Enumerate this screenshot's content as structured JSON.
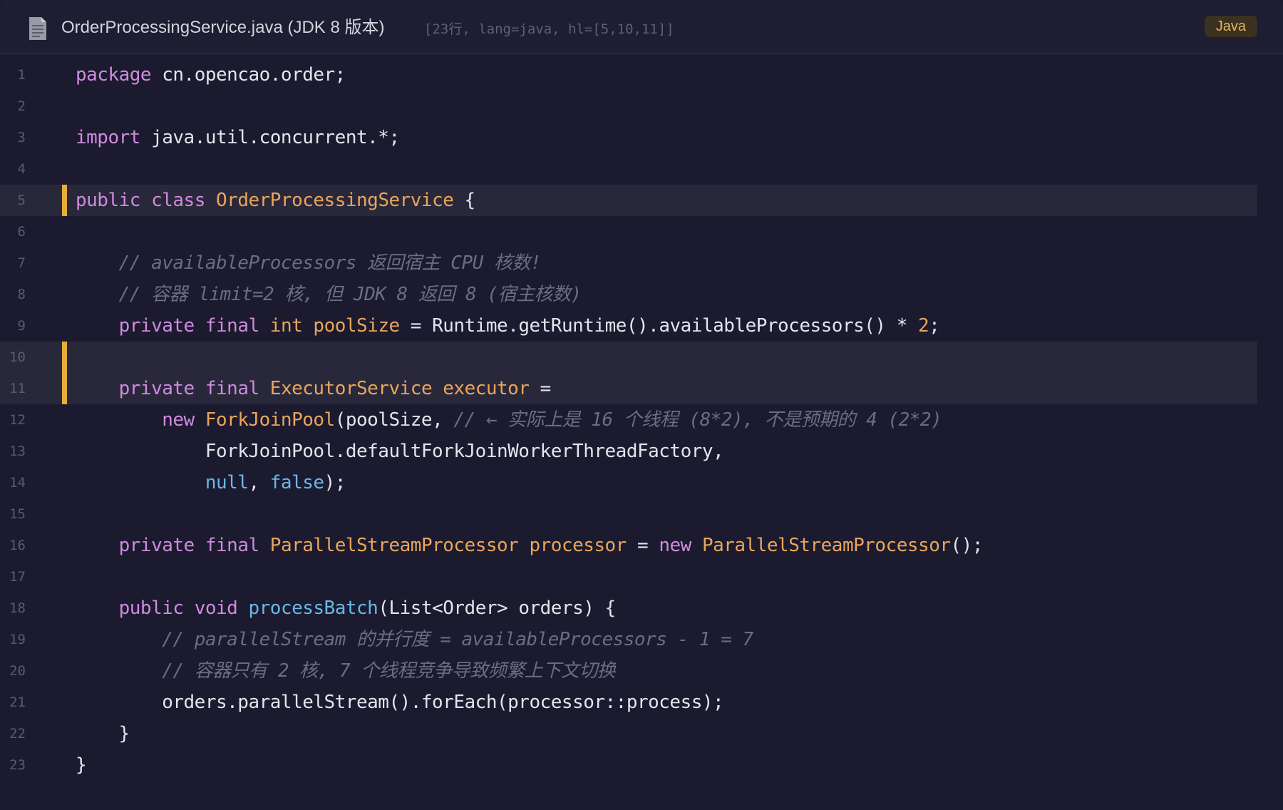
{
  "header": {
    "file_name": "OrderProcessingService.java (JDK 8 版本)",
    "meta": "[23行, lang=java, hl=[5,10,11]]",
    "language_badge": "Java",
    "file_icon": "document-icon"
  },
  "code": {
    "highlighted_lines": [
      5,
      10,
      11
    ],
    "lines": [
      {
        "n": "1",
        "tokens": [
          {
            "t": "package",
            "c": "kw"
          },
          {
            "t": " cn.opencao.order;",
            "c": "pl"
          }
        ]
      },
      {
        "n": "2",
        "tokens": []
      },
      {
        "n": "3",
        "tokens": [
          {
            "t": "import",
            "c": "kw"
          },
          {
            "t": " java.util.concurrent.*;",
            "c": "pl"
          }
        ]
      },
      {
        "n": "4",
        "tokens": []
      },
      {
        "n": "5",
        "tokens": [
          {
            "t": "public",
            "c": "kw"
          },
          {
            "t": " ",
            "c": "pl"
          },
          {
            "t": "class",
            "c": "kw"
          },
          {
            "t": " ",
            "c": "pl"
          },
          {
            "t": "OrderProcessingService",
            "c": "ty"
          },
          {
            "t": " {",
            "c": "pl"
          }
        ]
      },
      {
        "n": "6",
        "tokens": []
      },
      {
        "n": "7",
        "tokens": [
          {
            "t": "    ",
            "c": "pl"
          },
          {
            "t": "// availableProcessors 返回宿主 CPU 核数!",
            "c": "cm"
          }
        ]
      },
      {
        "n": "8",
        "tokens": [
          {
            "t": "    ",
            "c": "pl"
          },
          {
            "t": "// 容器 limit=2 核, 但 JDK 8 返回 8 (宿主核数)",
            "c": "cm"
          }
        ]
      },
      {
        "n": "9",
        "tokens": [
          {
            "t": "    ",
            "c": "pl"
          },
          {
            "t": "private",
            "c": "kw"
          },
          {
            "t": " ",
            "c": "pl"
          },
          {
            "t": "final",
            "c": "kw"
          },
          {
            "t": " ",
            "c": "pl"
          },
          {
            "t": "int",
            "c": "ty"
          },
          {
            "t": " ",
            "c": "pl"
          },
          {
            "t": "poolSize",
            "c": "nm"
          },
          {
            "t": " = Runtime.getRuntime().availableProcessors() * ",
            "c": "pl"
          },
          {
            "t": "2",
            "c": "nm"
          },
          {
            "t": ";",
            "c": "pl"
          }
        ]
      },
      {
        "n": "10",
        "tokens": []
      },
      {
        "n": "11",
        "tokens": [
          {
            "t": "    ",
            "c": "pl"
          },
          {
            "t": "private",
            "c": "kw"
          },
          {
            "t": " ",
            "c": "pl"
          },
          {
            "t": "final",
            "c": "kw"
          },
          {
            "t": " ",
            "c": "pl"
          },
          {
            "t": "ExecutorService",
            "c": "ty"
          },
          {
            "t": " ",
            "c": "pl"
          },
          {
            "t": "executor",
            "c": "nm"
          },
          {
            "t": " =",
            "c": "pl"
          }
        ]
      },
      {
        "n": "12",
        "tokens": [
          {
            "t": "        ",
            "c": "pl"
          },
          {
            "t": "new",
            "c": "kw"
          },
          {
            "t": " ",
            "c": "pl"
          },
          {
            "t": "ForkJoinPool",
            "c": "ty"
          },
          {
            "t": "(poolSize, ",
            "c": "pl"
          },
          {
            "t": "// ← 实际上是 16 个线程 (8*2), 不是预期的 4 (2*2)",
            "c": "cm"
          }
        ]
      },
      {
        "n": "13",
        "tokens": [
          {
            "t": "            ForkJoinPool.defaultForkJoinWorkerThreadFactory,",
            "c": "pl"
          }
        ]
      },
      {
        "n": "14",
        "tokens": [
          {
            "t": "            ",
            "c": "pl"
          },
          {
            "t": "null",
            "c": "lit"
          },
          {
            "t": ", ",
            "c": "pl"
          },
          {
            "t": "false",
            "c": "lit"
          },
          {
            "t": ");",
            "c": "pl"
          }
        ]
      },
      {
        "n": "15",
        "tokens": []
      },
      {
        "n": "16",
        "tokens": [
          {
            "t": "    ",
            "c": "pl"
          },
          {
            "t": "private",
            "c": "kw"
          },
          {
            "t": " ",
            "c": "pl"
          },
          {
            "t": "final",
            "c": "kw"
          },
          {
            "t": " ",
            "c": "pl"
          },
          {
            "t": "ParallelStreamProcessor",
            "c": "ty"
          },
          {
            "t": " ",
            "c": "pl"
          },
          {
            "t": "processor",
            "c": "nm"
          },
          {
            "t": " = ",
            "c": "pl"
          },
          {
            "t": "new",
            "c": "kw"
          },
          {
            "t": " ",
            "c": "pl"
          },
          {
            "t": "ParallelStreamProcessor",
            "c": "ty"
          },
          {
            "t": "();",
            "c": "pl"
          }
        ]
      },
      {
        "n": "17",
        "tokens": []
      },
      {
        "n": "18",
        "tokens": [
          {
            "t": "    ",
            "c": "pl"
          },
          {
            "t": "public",
            "c": "kw"
          },
          {
            "t": " ",
            "c": "pl"
          },
          {
            "t": "void",
            "c": "kw"
          },
          {
            "t": " ",
            "c": "pl"
          },
          {
            "t": "processBatch",
            "c": "fn"
          },
          {
            "t": "(List<Order> orders) {",
            "c": "pl"
          }
        ]
      },
      {
        "n": "19",
        "tokens": [
          {
            "t": "        ",
            "c": "pl"
          },
          {
            "t": "// parallelStream 的并行度 = availableProcessors - 1 = 7",
            "c": "cm"
          }
        ]
      },
      {
        "n": "20",
        "tokens": [
          {
            "t": "        ",
            "c": "pl"
          },
          {
            "t": "// 容器只有 2 核, 7 个线程竞争导致频繁上下文切换",
            "c": "cm"
          }
        ]
      },
      {
        "n": "21",
        "tokens": [
          {
            "t": "        orders.parallelStream().forEach(processor::process);",
            "c": "pl"
          }
        ]
      },
      {
        "n": "22",
        "tokens": [
          {
            "t": "    }",
            "c": "pl"
          }
        ]
      },
      {
        "n": "23",
        "tokens": [
          {
            "t": "}",
            "c": "pl"
          }
        ]
      }
    ]
  },
  "colors": {
    "background": "#1b1a2e",
    "highlight_bar": "#e6ad3a",
    "keyword": "#cf8be0",
    "type": "#eaa55c",
    "function": "#6ab8e8",
    "comment": "#6c6d82"
  }
}
